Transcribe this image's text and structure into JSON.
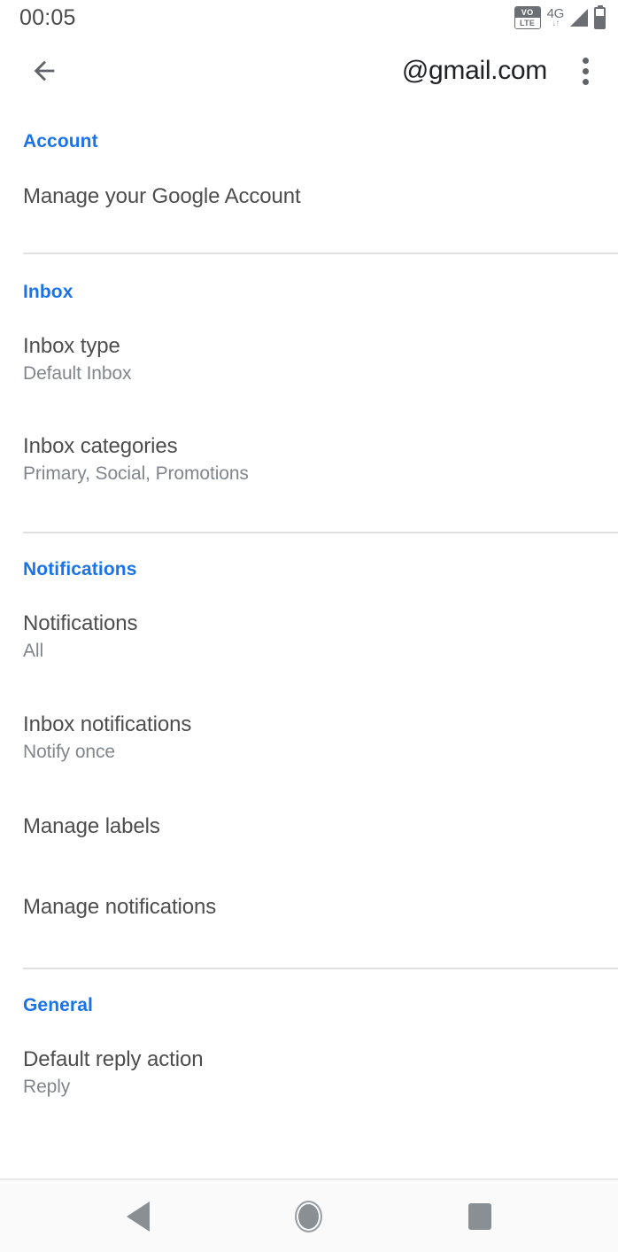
{
  "statusbar": {
    "clock": "00:05",
    "volte_top": "VO",
    "volte_bottom": "LTE",
    "network": "4G",
    "data_arrows": "↓↑",
    "signal_icon": "signal-bars-icon",
    "battery_icon": "battery-icon",
    "battery_level_percent": 60
  },
  "appbar": {
    "back_icon": "back-arrow-icon",
    "title": "@gmail.com",
    "overflow_icon": "more-vert-icon"
  },
  "colors": {
    "accent_blue": "#1a73e8",
    "primary_text": "#4d4d4d",
    "secondary_text": "#80868b",
    "title_text": "#202124",
    "divider": "#e0e0e0",
    "navbar_bg": "#fafafa",
    "nav_icon": "#8a8f94"
  },
  "sections": [
    {
      "header": "Account",
      "items": [
        {
          "title": "Manage your Google Account",
          "sub": ""
        }
      ]
    },
    {
      "header": "Inbox",
      "items": [
        {
          "title": "Inbox type",
          "sub": "Default Inbox"
        },
        {
          "title": "Inbox categories",
          "sub": "Primary, Social, Promotions"
        }
      ]
    },
    {
      "header": "Notifications",
      "items": [
        {
          "title": "Notifications",
          "sub": "All"
        },
        {
          "title": "Inbox notifications",
          "sub": "Notify once"
        },
        {
          "title": "Manage labels",
          "sub": ""
        },
        {
          "title": "Manage notifications",
          "sub": ""
        }
      ]
    },
    {
      "header": "General",
      "items": [
        {
          "title": "Default reply action",
          "sub": "Reply"
        }
      ]
    }
  ],
  "navbar": {
    "back_label": "back-nav",
    "home_label": "home-nav",
    "recents_label": "recents-nav"
  }
}
